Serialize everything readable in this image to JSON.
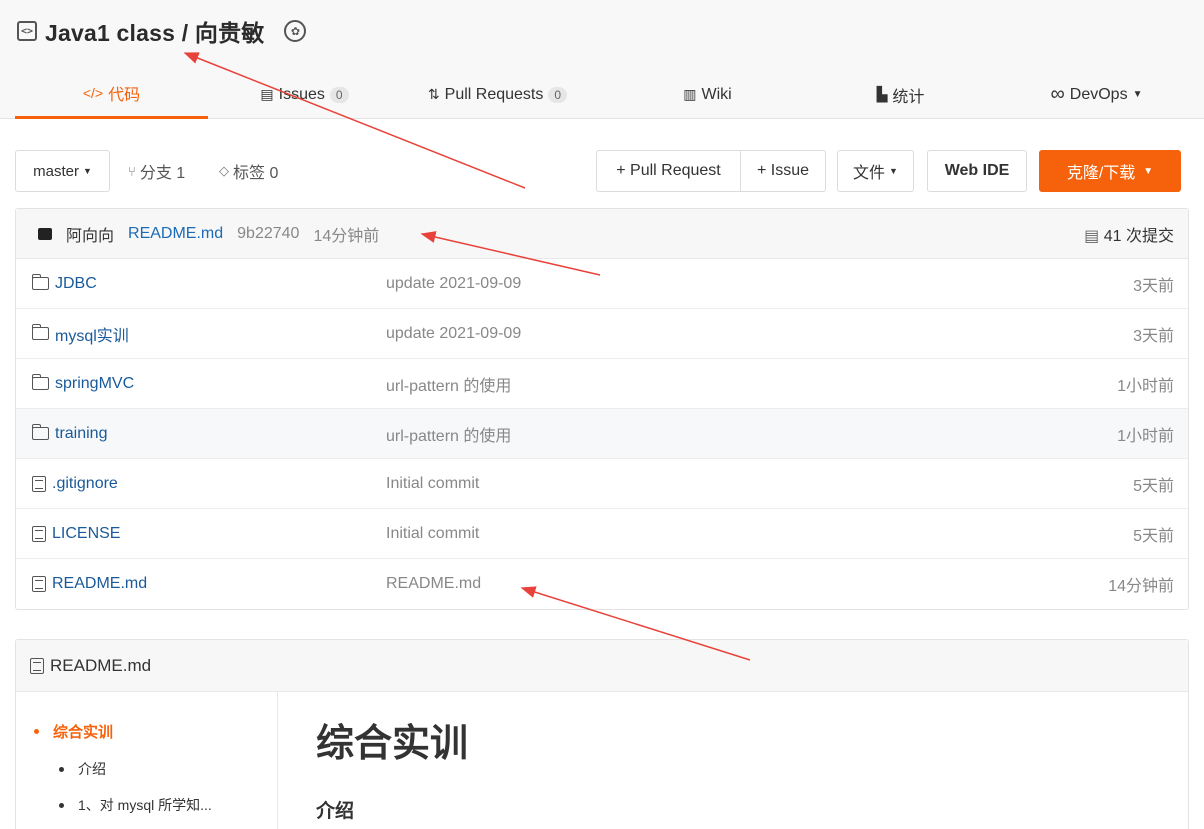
{
  "repo": {
    "title": "Java1 class / 向贵敏"
  },
  "tabs": [
    {
      "label": "代码",
      "icon": "code-icon"
    },
    {
      "label": "Issues",
      "count": "0",
      "icon": "issue-icon"
    },
    {
      "label": "Pull Requests",
      "count": "0",
      "icon": "pull-request-icon"
    },
    {
      "label": "Wiki",
      "icon": "book-icon"
    },
    {
      "label": "统计",
      "icon": "chart-icon"
    },
    {
      "label": "DevOps",
      "icon": "infinity-icon"
    }
  ],
  "toolbar": {
    "branch": "master",
    "branches": "分支 1",
    "tags": "标签 0",
    "pull_request": "+ Pull Request",
    "issue": "+ Issue",
    "file": "文件",
    "web_ide": "Web IDE",
    "clone": "克隆/下载"
  },
  "commit": {
    "author": "阿向向",
    "message": "README.md",
    "sha": "9b22740",
    "time": "14分钟前",
    "count": "41 次提交"
  },
  "files": [
    {
      "name": "JDBC",
      "type": "folder",
      "message": "update 2021-09-09",
      "time": "3天前"
    },
    {
      "name": "mysql实训",
      "type": "folder",
      "message": "update 2021-09-09",
      "time": "3天前"
    },
    {
      "name": "springMVC",
      "type": "folder",
      "message": "url-pattern 的使用",
      "time": "1小时前"
    },
    {
      "name": "training",
      "type": "folder",
      "message": "url-pattern 的使用",
      "time": "1小时前"
    },
    {
      "name": ".gitignore",
      "type": "file",
      "message": "Initial commit",
      "time": "5天前"
    },
    {
      "name": "LICENSE",
      "type": "file",
      "message": "Initial commit",
      "time": "5天前"
    },
    {
      "name": "README.md",
      "type": "file",
      "message": "README.md",
      "time": "14分钟前"
    }
  ],
  "readme": {
    "filename": "README.md",
    "toc": [
      "综合实训",
      "介绍",
      "1、对 mysql 所学知..."
    ],
    "h1": "综合实训",
    "h2": "介绍"
  },
  "colors": {
    "accent": "#f6620c",
    "link": "#1b5a9a",
    "annotation_arrow": "#e8423a"
  }
}
